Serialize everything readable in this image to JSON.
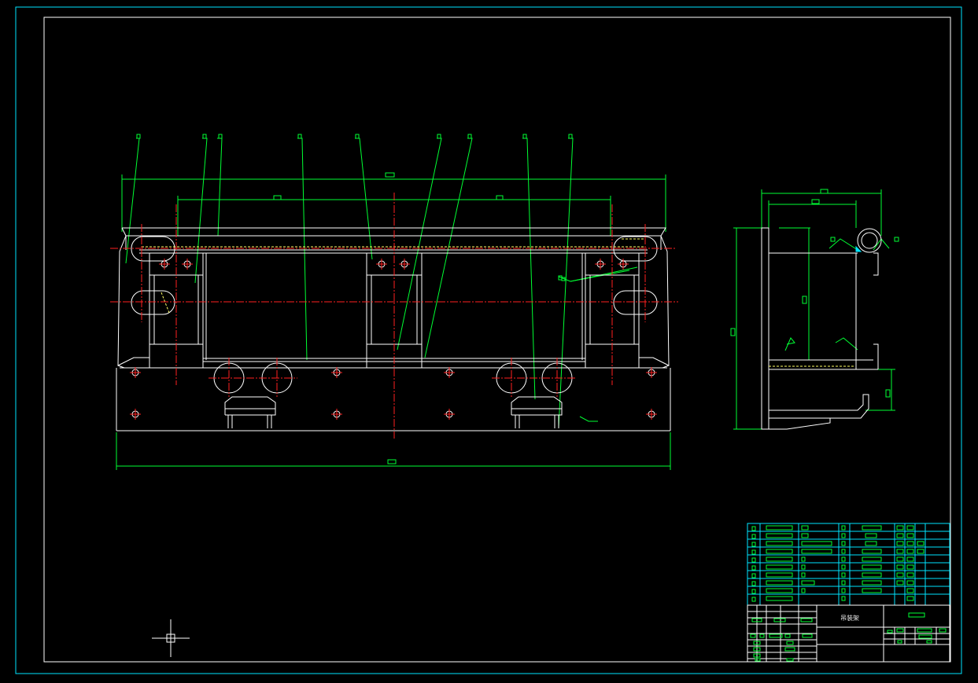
{
  "drawing": {
    "title_block_name": "吊装架",
    "background_color": "#000000",
    "colors": {
      "outline": "#ffffff",
      "border": "#00e5ff",
      "dimension": "#00ff33",
      "centerline": "#ff2020",
      "hidden": "#ffff66"
    }
  },
  "cursor": {
    "icon": "crosshair-cursor-icon"
  }
}
